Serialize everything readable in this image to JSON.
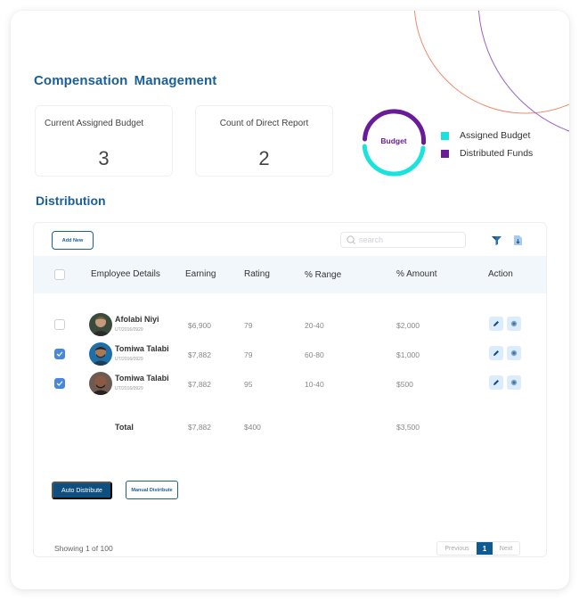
{
  "page": {
    "title": "Compensation  Management",
    "section_title": "Distribution"
  },
  "stats": [
    {
      "label": "Current Assigned Budget",
      "value": "3"
    },
    {
      "label": "Count of Direct Report",
      "value": "2"
    }
  ],
  "budget_chart": {
    "center_label": "Budget",
    "legend": [
      {
        "label": "Assigned Budget",
        "color": "#19e3dc"
      },
      {
        "label": "Distributed Funds",
        "color": "#6a1b9a"
      }
    ]
  },
  "toolbar": {
    "add_new_label": "Add New",
    "search_placeholder": "search",
    "filter_icon": "filter-icon",
    "download_icon": "download-icon"
  },
  "table": {
    "headers": [
      "Employee Details",
      "Earning",
      "Rating",
      "% Range",
      "% Amount",
      "Action"
    ],
    "rows": [
      {
        "checked": false,
        "name": "Afolabi Niyi",
        "id": "UT/2016/0929",
        "earning": "$6,900",
        "rating": "79",
        "range": "20-40",
        "amount": "$2,000"
      },
      {
        "checked": true,
        "name": "Tomiwa Talabi",
        "id": "UT/2016/0929",
        "earning": "$7,882",
        "rating": "79",
        "range": "60-80",
        "amount": "$1,000"
      },
      {
        "checked": true,
        "name": "Tomiwa Talabi",
        "id": "UT/2016/0929",
        "earning": "$7,882",
        "rating": "95",
        "range": "10-40",
        "amount": "$500"
      }
    ],
    "total": {
      "label": "Total",
      "earning": "$7,882",
      "rating": "$400",
      "amount": "$3,500"
    }
  },
  "actions": {
    "auto_distribute_label": "Auto Distribute",
    "manual_distribute_label": "Manual Distribute"
  },
  "footer": {
    "showing_text": "Showing 1 of 100",
    "previous_label": "Previous",
    "current_page": "1",
    "next_label": "Next"
  },
  "colors": {
    "primary": "#1a5f98",
    "primary_dark": "#0e4f80",
    "checkbox_checked": "#4a86d9",
    "header_bg": "#f2f7fc",
    "deco_orange": "#f07a5a",
    "deco_purple": "#8a4fc0"
  }
}
